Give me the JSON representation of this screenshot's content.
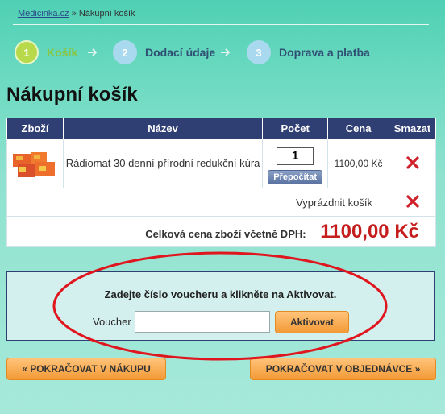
{
  "breadcrumb": {
    "home": "Medicinka.cz",
    "separator": "»",
    "current": "Nákupní košík"
  },
  "steps": [
    {
      "number": "1",
      "label": "Košík",
      "active": true
    },
    {
      "number": "2",
      "label": "Dodací údaje",
      "active": false
    },
    {
      "number": "3",
      "label": "Doprava a platba",
      "active": false
    }
  ],
  "page_title": "Nákupní košík",
  "table": {
    "headers": [
      "Zboží",
      "Název",
      "Počet",
      "Cena",
      "Smazat"
    ],
    "items": [
      {
        "name": "Rádiomat 30 denní přírodní redukční kúra",
        "quantity": "1",
        "recalc_label": "Přepočítat",
        "price": "1100,00 Kč",
        "image_icon": "product-box-icon",
        "delete_icon": "delete-x-icon"
      }
    ],
    "empty_cart_label": "Vyprázdnit košík",
    "total_label": "Celková cena zboží včetně DPH:",
    "total_value": "1100,00 Kč"
  },
  "voucher": {
    "instruction": "Zadejte číslo voucheru a klikněte na Aktivovat.",
    "label": "Voucher",
    "value": "",
    "button": "Aktivovat"
  },
  "buttons": {
    "back": "« POKRAČOVAT V NÁKUPU",
    "next": "POKRAČOVAT V OBJEDNÁVCE »"
  },
  "colors": {
    "header_bg": "#2f3e73",
    "accent_orange": "#f39a36",
    "total_red": "#c51d1d",
    "active_step": "#8cc43a",
    "annotation_red": "#e0161e"
  }
}
